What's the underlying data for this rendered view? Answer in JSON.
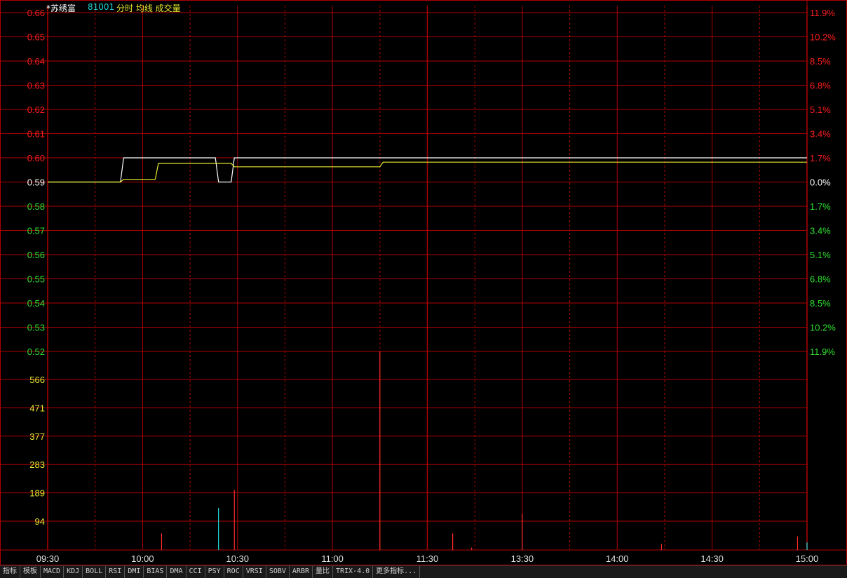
{
  "header": {
    "stock_name": "*苏绣富",
    "code": "81001",
    "tabs": "分时 均线 成交量"
  },
  "colors": {
    "grid": "#b00000",
    "axis_up": "#ff1e1e",
    "axis_down": "#2ee02e",
    "axis_flat": "#ffffff",
    "volume_axis": "#e8e830",
    "price_line": "#ffffff",
    "avg_line": "#e8e830",
    "vol_bar": "#ff2a2a",
    "vol_bar_down": "#20e0e0",
    "time_label": "#e0e0e0"
  },
  "chart_data": {
    "type": "line",
    "price_axis": {
      "left_labels": [
        "0.66",
        "0.65",
        "0.64",
        "0.63",
        "0.62",
        "0.61",
        "0.60",
        "0.59",
        "0.58",
        "0.57",
        "0.56",
        "0.55",
        "0.54",
        "0.53",
        "0.52"
      ],
      "right_labels": [
        "11.9%",
        "10.2%",
        "8.5%",
        "6.8%",
        "5.1%",
        "3.4%",
        "1.7%",
        "0.0%",
        "1.7%",
        "3.4%",
        "5.1%",
        "6.8%",
        "8.5%",
        "10.2%",
        "11.9%"
      ],
      "ylim": [
        0.52,
        0.66
      ],
      "prev_close": 0.59
    },
    "volume_axis": {
      "labels": [
        "566",
        "471",
        "377",
        "283",
        "189",
        "94"
      ],
      "ylim": [
        0,
        660
      ]
    },
    "time_labels": [
      "09:30",
      "10:00",
      "10:30",
      "11:00",
      "11:30",
      "13:30",
      "14:00",
      "14:30",
      "15:00"
    ],
    "series": [
      {
        "values_desc": "price",
        "x": [
          0,
          23,
          24,
          53,
          54,
          58,
          59,
          240
        ],
        "y": [
          0.59,
          0.59,
          0.6,
          0.6,
          0.59,
          0.59,
          0.6,
          0.6
        ]
      },
      {
        "values_desc": "average",
        "x": [
          0,
          23,
          24,
          34,
          35,
          58,
          59,
          105,
          106,
          240
        ],
        "y": [
          0.59,
          0.59,
          0.5911,
          0.5911,
          0.5977,
          0.5977,
          0.5963,
          0.5963,
          0.5982,
          0.5982
        ]
      }
    ],
    "volume": [
      {
        "x": 36,
        "v": 55,
        "dir": "up"
      },
      {
        "x": 54,
        "v": 140,
        "dir": "down"
      },
      {
        "x": 59,
        "v": 200,
        "dir": "up"
      },
      {
        "x": 105,
        "v": 790,
        "dir": "up"
      },
      {
        "x": 128,
        "v": 55,
        "dir": "up"
      },
      {
        "x": 134,
        "v": 8,
        "dir": "up"
      },
      {
        "x": 150,
        "v": 120,
        "dir": "up"
      },
      {
        "x": 194,
        "v": 20,
        "dir": "up"
      },
      {
        "x": 237,
        "v": 45,
        "dir": "up"
      },
      {
        "x": 240,
        "v": 25,
        "dir": "down"
      }
    ]
  },
  "tabbar": [
    "指标",
    "模板",
    "MACD",
    "KDJ",
    "BOLL",
    "RSI",
    "DMI",
    "BIAS",
    "DMA",
    "CCI",
    "PSY",
    "ROC",
    "VRSI",
    "SOBV",
    "ARBR",
    "量比",
    "TRIX-4.0",
    "更多指标..."
  ]
}
